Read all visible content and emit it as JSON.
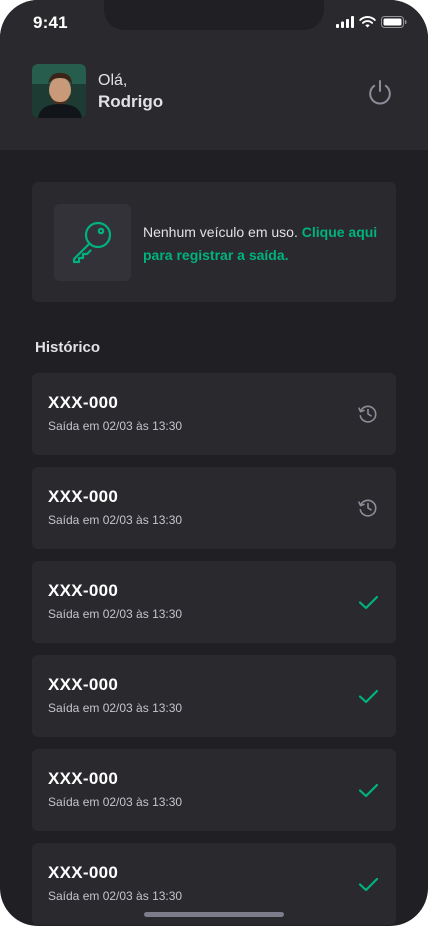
{
  "status_bar": {
    "time": "9:41"
  },
  "header": {
    "greeting": "Olá,",
    "user_name": "Rodrigo",
    "avatar_icon": "user-avatar",
    "logout_icon": "power-icon"
  },
  "notice": {
    "icon": "key-icon",
    "text": "Nenhum veículo em uso.",
    "link": "Clique aqui para registrar a saída."
  },
  "history": {
    "title": "Histórico",
    "items": [
      {
        "plate": "XXX-000",
        "departure": "Saída em 02/03 às 13:30",
        "status": "pending"
      },
      {
        "plate": "XXX-000",
        "departure": "Saída em 02/03 às 13:30",
        "status": "pending"
      },
      {
        "plate": "XXX-000",
        "departure": "Saída em 02/03 às 13:30",
        "status": "done"
      },
      {
        "plate": "XXX-000",
        "departure": "Saída em 02/03 às 13:30",
        "status": "done"
      },
      {
        "plate": "XXX-000",
        "departure": "Saída em 02/03 às 13:30",
        "status": "done"
      },
      {
        "plate": "XXX-000",
        "departure": "Saída em 02/03 às 13:30",
        "status": "done"
      }
    ]
  },
  "colors": {
    "background": "#202024",
    "card": "#29292e",
    "accent": "#00b37e",
    "text": "#e1e1e6",
    "muted": "#7c7c8a"
  }
}
